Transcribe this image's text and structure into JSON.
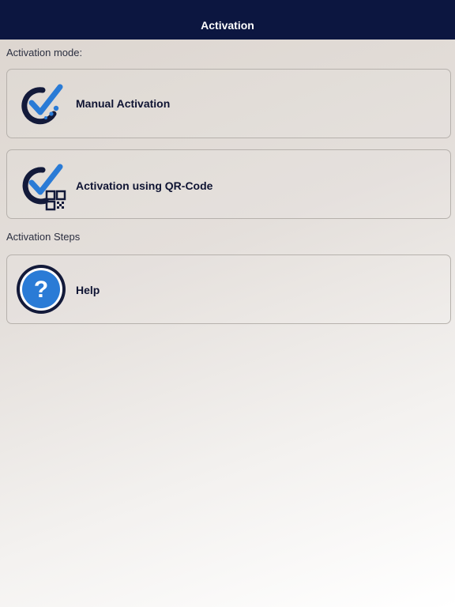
{
  "navbar": {
    "title": "Activation"
  },
  "sections": {
    "mode_label": "Activation mode:",
    "steps_label": "Activation Steps"
  },
  "items": {
    "manual": {
      "label": "Manual Activation",
      "icon": "check-activation-icon"
    },
    "qr": {
      "label": "Activation using QR-Code",
      "icon": "qr-activation-icon"
    },
    "help": {
      "label": "Help",
      "icon": "help-icon"
    }
  },
  "colors": {
    "navbar": "#0c1640",
    "accent_blue": "#2a7bd6",
    "dark_navy": "#131a3a"
  }
}
